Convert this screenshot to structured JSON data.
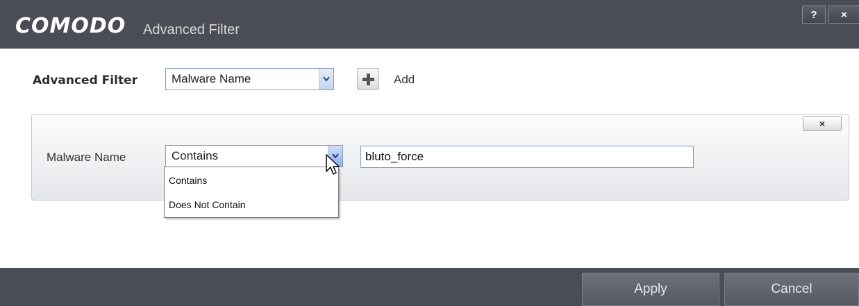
{
  "window": {
    "brand": "COMODO",
    "title": "Advanced Filter",
    "help_label": "?",
    "close_label": "×"
  },
  "filter": {
    "label": "Advanced Filter",
    "selected": "Malware Name",
    "add_label": "Add"
  },
  "rule": {
    "close_label": "×",
    "field_label": "Malware Name",
    "condition_selected": "Contains",
    "value": "bluto_force"
  },
  "dropdown": {
    "options": [
      "Contains",
      "Does Not Contain"
    ]
  },
  "footer": {
    "apply_label": "Apply",
    "cancel_label": "Cancel"
  },
  "colors": {
    "titlebar": "#4a4d55",
    "panel_border": "#c9cbd0",
    "input_border": "#7f9db9"
  }
}
